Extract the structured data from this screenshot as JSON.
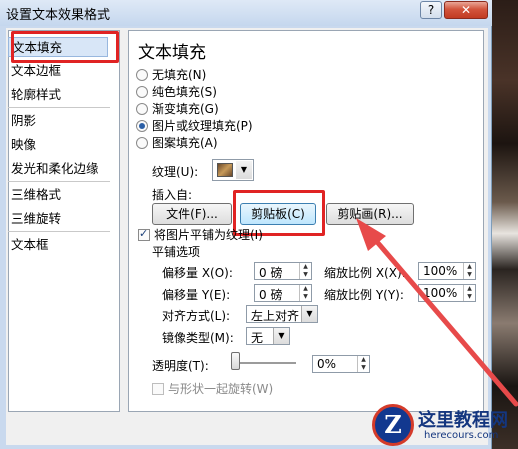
{
  "window": {
    "title": "设置文本效果格式",
    "help_glyph": "?",
    "close_glyph": "✕"
  },
  "nav": {
    "items": [
      "文本填充",
      "文本边框",
      "轮廓样式",
      "阴影",
      "映像",
      "发光和柔化边缘",
      "三维格式",
      "三维旋转",
      "文本框"
    ],
    "selected_index": 0
  },
  "panel": {
    "title": "文本填充",
    "fill_options": [
      {
        "label": "无填充(N)",
        "selected": false
      },
      {
        "label": "纯色填充(S)",
        "selected": false
      },
      {
        "label": "渐变填充(G)",
        "selected": false
      },
      {
        "label": "图片或纹理填充(P)",
        "selected": true
      },
      {
        "label": "图案填充(A)",
        "selected": false
      }
    ],
    "texture_label": "纹理(U):",
    "insert_from_label": "插入自:",
    "buttons": {
      "file": "文件(F)...",
      "clipboard": "剪贴板(C)",
      "clipart": "剪贴画(R)..."
    },
    "tile_checkbox": {
      "label": "将图片平铺为纹理(I)",
      "checked": true
    },
    "tile_options_label": "平铺选项",
    "offset_x": {
      "label": "偏移量 X(O):",
      "value": "0 磅"
    },
    "offset_y": {
      "label": "偏移量 Y(E):",
      "value": "0 磅"
    },
    "scale_x": {
      "label": "缩放比例 X(X):",
      "value": "100%"
    },
    "scale_y": {
      "label": "缩放比例 Y(Y):",
      "value": "100%"
    },
    "alignment": {
      "label": "对齐方式(L):",
      "value": "左上对齐"
    },
    "mirror": {
      "label": "镜像类型(M):",
      "value": "无"
    },
    "transparency": {
      "label": "透明度(T):",
      "value": "0%",
      "level": 0
    },
    "rotate_with_shape": {
      "label": "与形状一起旋转(W)",
      "checked": false,
      "enabled": false
    }
  },
  "watermark": {
    "brand_mark": "Z",
    "name": "这里教程网",
    "url": "herecours.com"
  },
  "colors": {
    "highlight_red": "#e02323",
    "accent_blue": "#2b5fa6"
  }
}
